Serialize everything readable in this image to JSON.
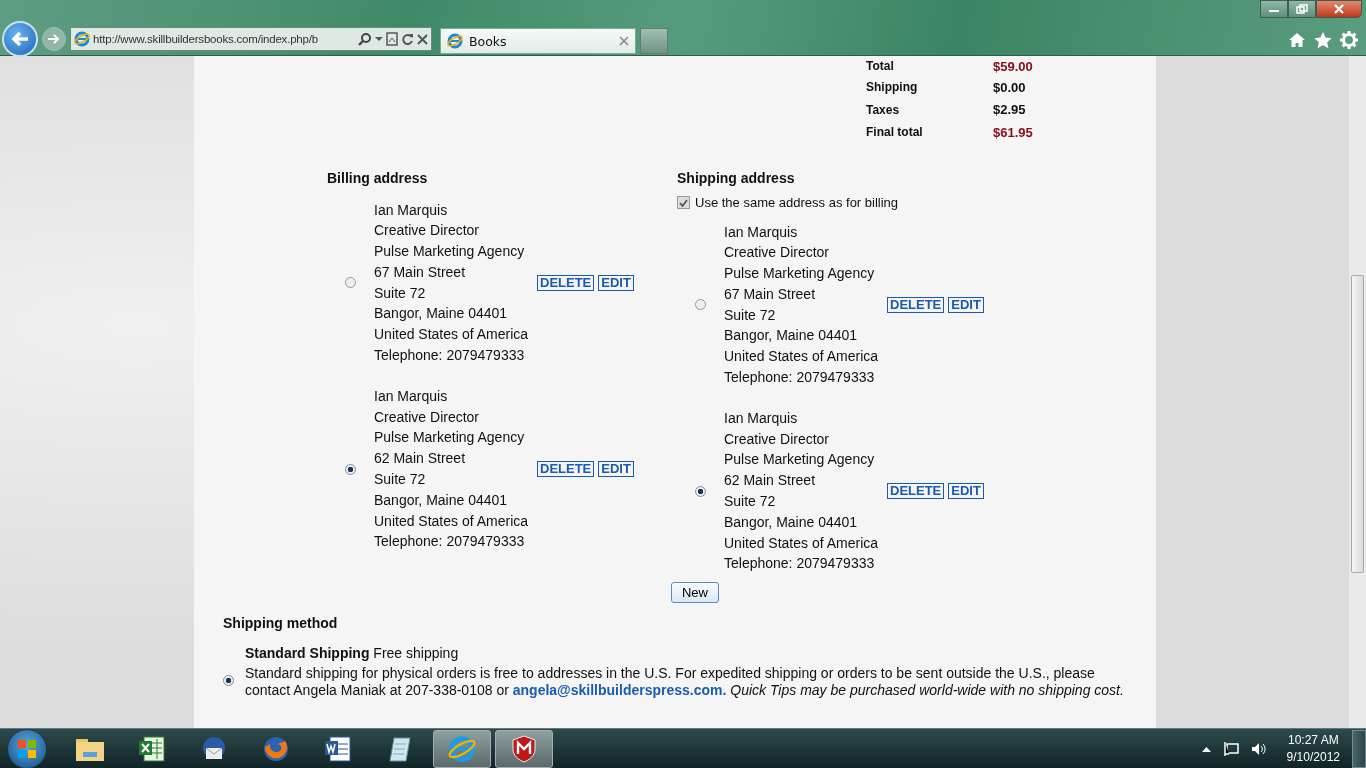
{
  "browser": {
    "url": "http://www.skillbuildersbooks.com/index.php/b",
    "tab_title": "Books"
  },
  "totals": [
    {
      "label": "Total",
      "value": "$59.00",
      "highlight": true
    },
    {
      "label": "Shipping",
      "value": "$0.00",
      "highlight": false
    },
    {
      "label": "Taxes",
      "value": "$2.95",
      "highlight": false
    },
    {
      "label": "Final total",
      "value": "$61.95",
      "highlight": true
    }
  ],
  "billing": {
    "title": "Billing address",
    "addresses": [
      {
        "lines": [
          "Ian Marquis",
          "Creative Director",
          "Pulse Marketing Agency",
          "67 Main Street",
          "Suite 72",
          "Bangor, Maine 04401",
          "United States of America",
          "Telephone: 2079479333"
        ],
        "selected": false,
        "delete": "DELETE",
        "edit": "EDIT"
      },
      {
        "lines": [
          "Ian Marquis",
          "Creative Director",
          "Pulse Marketing Agency",
          "62 Main Street",
          "Suite 72",
          "Bangor, Maine 04401",
          "United States of America",
          "Telephone: 2079479333"
        ],
        "selected": true,
        "delete": "DELETE",
        "edit": "EDIT"
      }
    ]
  },
  "shipping": {
    "title": "Shipping address",
    "same_as_billing": {
      "label": "Use the same address as for billing",
      "checked": true
    },
    "addresses": [
      {
        "lines": [
          "Ian Marquis",
          "Creative Director",
          "Pulse Marketing Agency",
          "67 Main Street",
          "Suite 72",
          "Bangor, Maine 04401",
          "United States of America",
          "Telephone: 2079479333"
        ],
        "selected": false,
        "delete": "DELETE",
        "edit": "EDIT"
      },
      {
        "lines": [
          "Ian Marquis",
          "Creative Director",
          "Pulse Marketing Agency",
          "62 Main Street",
          "Suite 72",
          "Bangor, Maine 04401",
          "United States of America",
          "Telephone: 2079479333"
        ],
        "selected": true,
        "delete": "DELETE",
        "edit": "EDIT"
      }
    ]
  },
  "new_button": "New",
  "shipping_method": {
    "title": "Shipping method",
    "options": [
      {
        "name": "Standard Shipping",
        "tag": "Free shipping",
        "description": "Standard shipping for physical orders is free to addresses in the U.S. For expedited shipping or orders to be sent outside the U.S., please contact Angela Maniak at 207-338-0108 or",
        "link": "angela@skillbuilderspress.com.",
        "note": "Quick Tips may be purchased world-wide with no shipping cost.",
        "selected": true
      }
    ]
  },
  "taskbar": {
    "apps": [
      {
        "kind": "folder",
        "open": false
      },
      {
        "kind": "spreadsheet",
        "open": false
      },
      {
        "kind": "mail",
        "open": false
      },
      {
        "kind": "firefox",
        "open": false
      },
      {
        "kind": "document",
        "open": false
      },
      {
        "kind": "notepad",
        "open": false
      },
      {
        "kind": "browser",
        "open": true
      },
      {
        "kind": "shield",
        "open": true
      }
    ],
    "time": "10:27 AM",
    "date": "9/10/2012"
  }
}
